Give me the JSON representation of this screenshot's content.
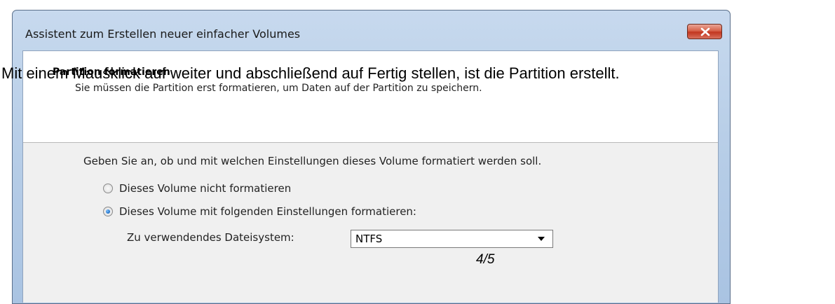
{
  "window": {
    "title": "Assistent zum Erstellen neuer einfacher Volumes"
  },
  "header": {
    "title": "Partition formatieren",
    "subtitle": "Sie müssen die Partition erst formatieren, um Daten auf der Partition zu speichern."
  },
  "body": {
    "intro": "Geben Sie an, ob und mit welchen Einstellungen dieses Volume formatiert werden soll.",
    "options": [
      {
        "label": "Dieses Volume nicht formatieren",
        "checked": false
      },
      {
        "label": "Dieses Volume mit folgenden Einstellungen formatieren:",
        "checked": true
      }
    ],
    "filesystem_label": "Zu verwendendes Dateisystem:",
    "filesystem_value": "NTFS"
  },
  "overlay": {
    "caption": "Mit einem Mausklick auf weiter und abschließend auf Fertig stellen, ist die Partition erstellt.",
    "pager": "4/5"
  },
  "icons": {
    "close": "close-icon",
    "dropdown": "chevron-down-icon"
  }
}
